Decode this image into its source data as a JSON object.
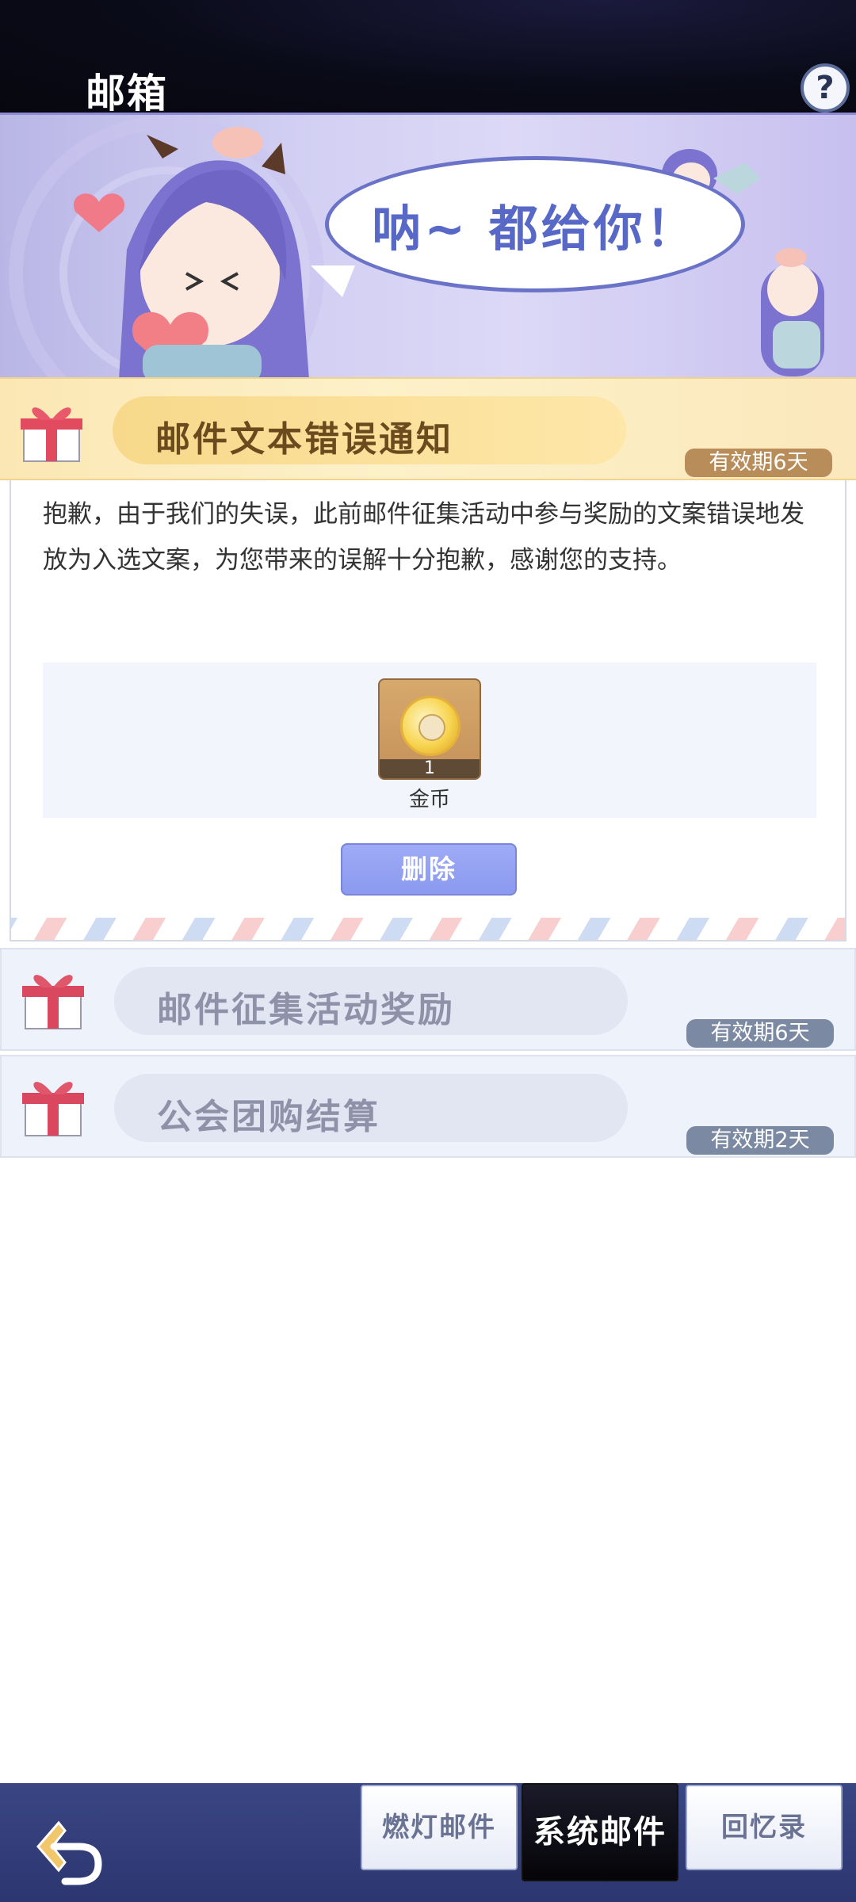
{
  "header": {
    "title": "邮箱",
    "help_label": "?"
  },
  "banner": {
    "speech_text": "呐~ 都给你！"
  },
  "mails": [
    {
      "title": "邮件文本错误通知",
      "validity": "有效期6天",
      "expanded": true,
      "body": "抱歉，由于我们的失误，此前邮件征集活动中参与奖励的文案错误地发放为入选文案，为您带来的误解十分抱歉，感谢您的支持。",
      "reward": {
        "name": "金币",
        "count": "1",
        "icon": "gold-coin-icon"
      },
      "delete_label": "删除"
    },
    {
      "title": "邮件征集活动奖励",
      "validity": "有效期6天"
    },
    {
      "title": "公会团购结算",
      "validity": "有效期2天"
    }
  ],
  "bottom_bar": {
    "back_icon": "back-arrow-icon",
    "tabs": [
      {
        "label": "燃灯邮件",
        "active": false
      },
      {
        "label": "系统邮件",
        "active": true
      },
      {
        "label": "回忆录",
        "active": false
      }
    ]
  },
  "colors": {
    "accent": "#8b99ef",
    "gold": "#b88d5a",
    "validity_gray": "#7b8aa2",
    "nav_bg": "#2c3670"
  }
}
